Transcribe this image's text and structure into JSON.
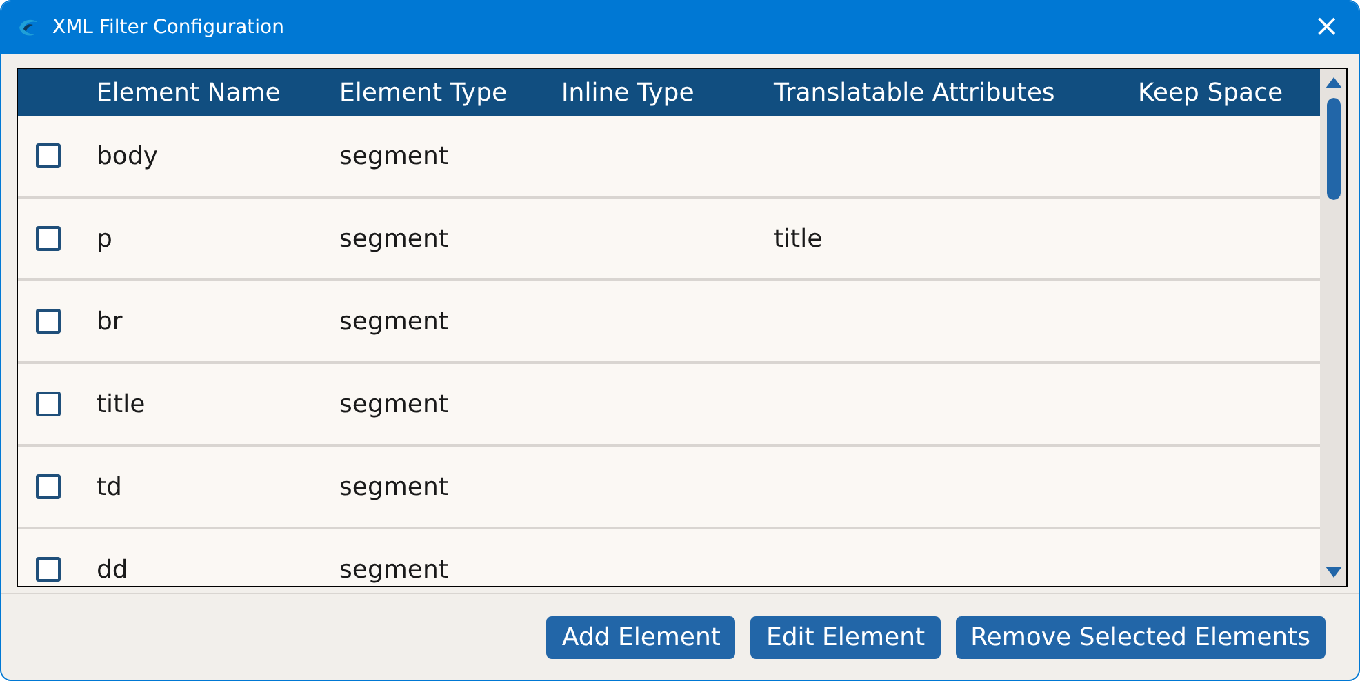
{
  "window": {
    "title": "XML Filter Configuration",
    "close": "×"
  },
  "table": {
    "columns": [
      "Element Name",
      "Element Type",
      "Inline Type",
      "Translatable Attributes",
      "Keep Space"
    ],
    "rows": [
      {
        "checked": false,
        "name": "body",
        "type": "segment"
      },
      {
        "checked": false,
        "name": "p",
        "type": "segment",
        "translatable_attributes": "title"
      },
      {
        "checked": false,
        "name": "br",
        "type": "segment"
      },
      {
        "checked": false,
        "name": "title",
        "type": "segment"
      },
      {
        "checked": false,
        "name": "td",
        "type": "segment"
      },
      {
        "checked": false,
        "name": "dd",
        "type": "segment"
      }
    ]
  },
  "buttons": [
    "Add Element",
    "Edit Element",
    "Remove Selected Elements"
  ]
}
